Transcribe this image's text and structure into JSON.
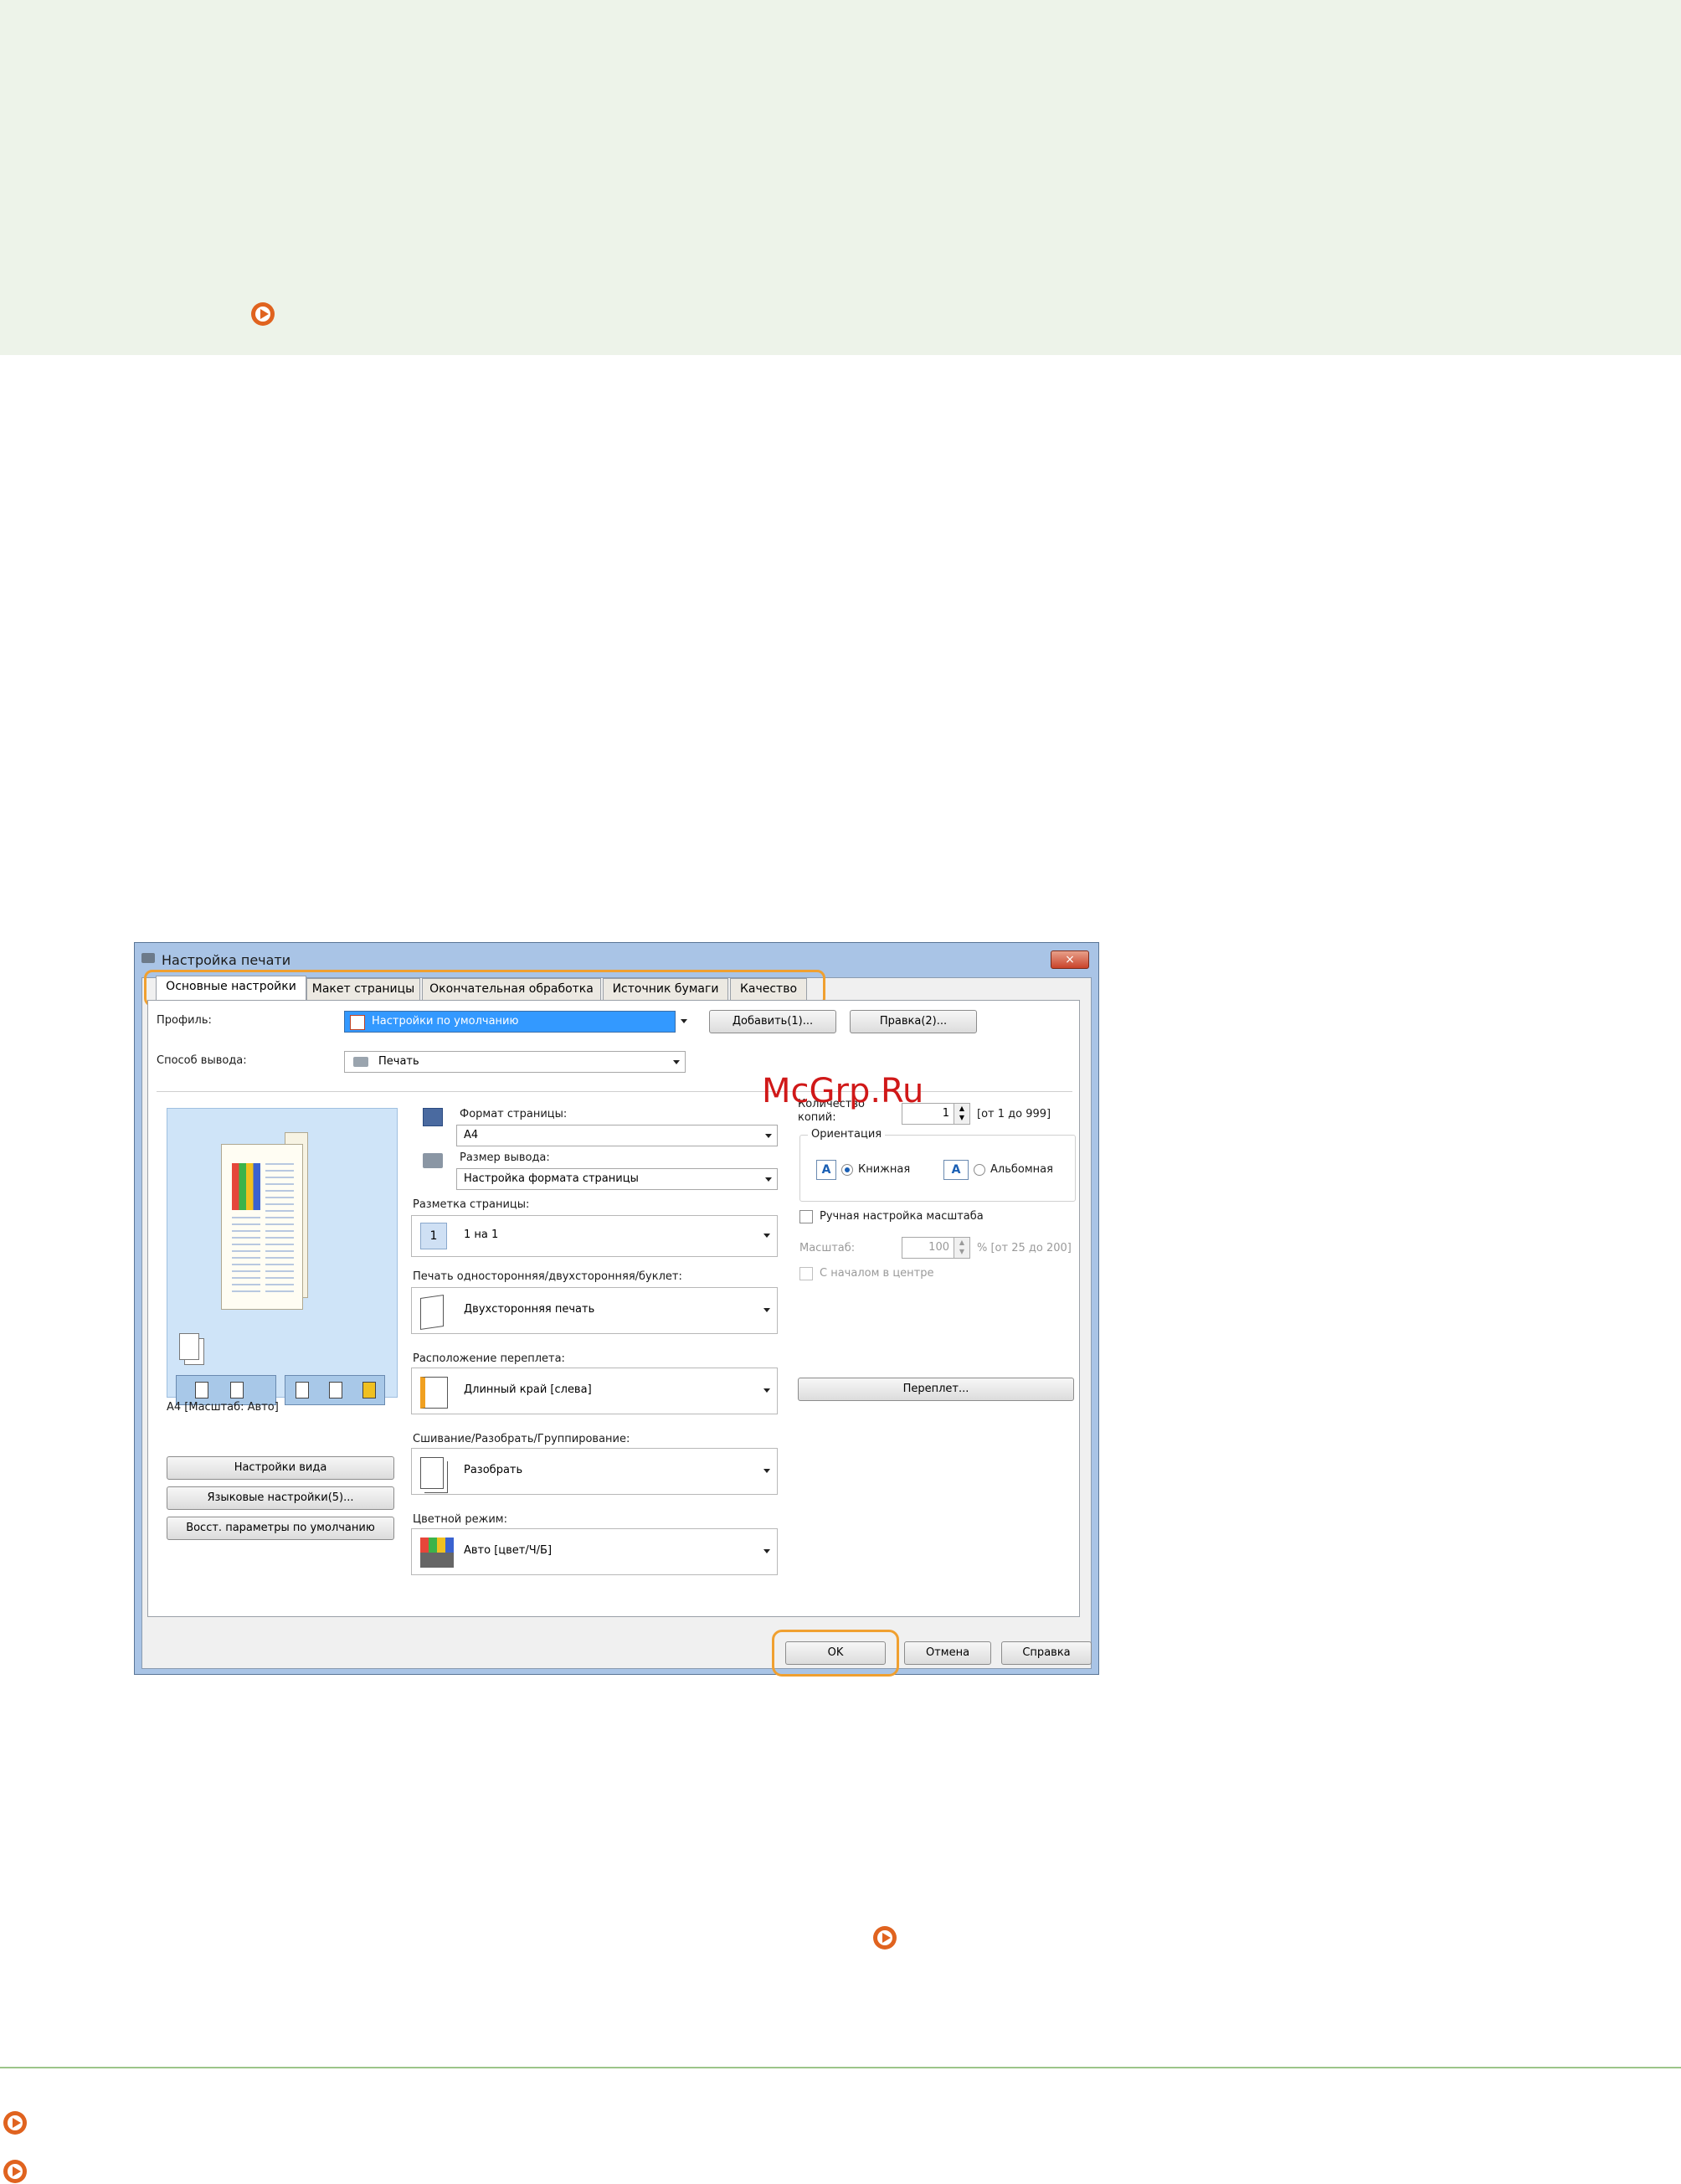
{
  "dialog": {
    "title": "Настройка печати",
    "close_label": "×",
    "tabs": [
      "Основные настройки",
      "Макет страницы",
      "Окончательная обработка",
      "Источник бумаги",
      "Качество"
    ],
    "profile": {
      "label": "Профиль:",
      "value": "Настройки по умолчанию",
      "add_button": "Добавить(1)...",
      "edit_button": "Правка(2)..."
    },
    "output": {
      "label": "Способ вывода:",
      "value": "Печать"
    },
    "preview": {
      "caption": "А4 [Масштаб: Авто]",
      "view_settings_button": "Настройки вида",
      "language_button": "Языковые настройки(5)...",
      "restore_button": "Восст. параметры по умолчанию"
    },
    "page_size": {
      "label": "Формат страницы:",
      "value": "А4"
    },
    "output_size": {
      "label": "Размер вывода:",
      "value": "Настройка формата страницы"
    },
    "layout": {
      "label": "Разметка страницы:",
      "value": "1 на 1",
      "icon_text": "1"
    },
    "duplex": {
      "label": "Печать односторонняя/двухсторонняя/буклет:",
      "value": "Двухсторонняя печать"
    },
    "binding": {
      "label": "Расположение переплета:",
      "value": "Длинный край [слева]"
    },
    "finishing": {
      "label": "Сшивание/Разобрать/Группирование:",
      "value": "Разобрать"
    },
    "color_mode": {
      "label": "Цветной режим:",
      "value": "Авто [цвет/Ч/Б]"
    },
    "copies": {
      "label_line1": "Количество",
      "label_line2": "копий:",
      "value": "1",
      "range": "[от 1 до 999]"
    },
    "orientation": {
      "label": "Ориентация",
      "portrait": "Книжная",
      "landscape": "Альбомная",
      "icon_text": "A"
    },
    "manual_scale": {
      "label": "Ручная настройка масштаба"
    },
    "scale": {
      "label": "Масштаб:",
      "value": "100",
      "range": "% [от 25 до 200]"
    },
    "center": {
      "label": "С началом в центре"
    },
    "binding_button": "Переплет...",
    "ok_button": "OK",
    "cancel_button": "Отмена",
    "help_button": "Справка"
  },
  "watermark": "McGrp.Ru",
  "colors": {
    "accent": "#e0631f",
    "highlight": "#f0a030",
    "note_bg": "#edf3e9"
  }
}
